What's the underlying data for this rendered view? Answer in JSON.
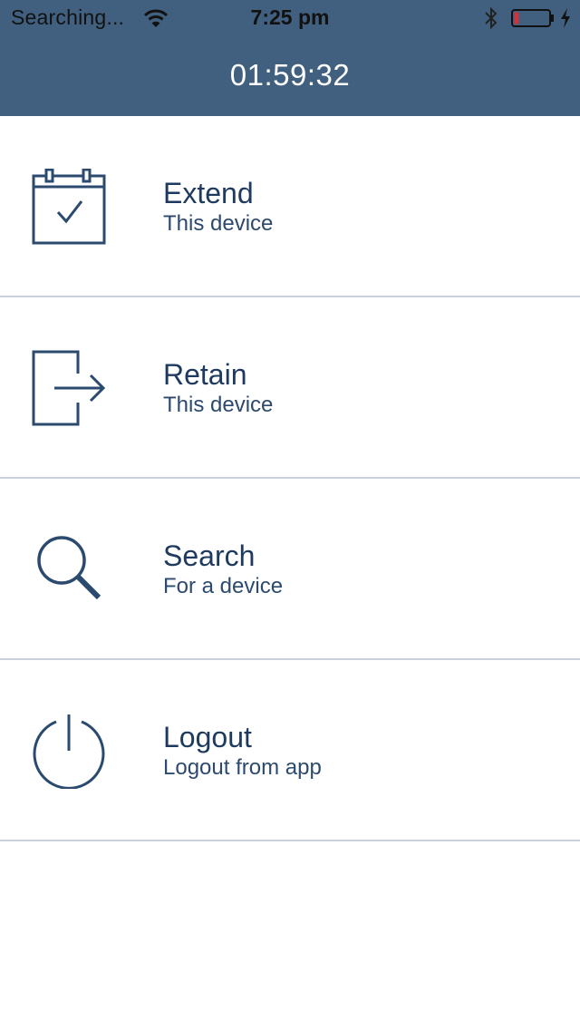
{
  "status_bar": {
    "carrier": "Searching...",
    "time": "7:25 pm"
  },
  "header": {
    "timer": "01:59:32"
  },
  "menu": {
    "items": [
      {
        "title": "Extend",
        "subtitle": "This device",
        "icon": "calendar-check-icon"
      },
      {
        "title": "Retain",
        "subtitle": "This device",
        "icon": "exit-arrow-icon"
      },
      {
        "title": "Search",
        "subtitle": "For a device",
        "icon": "search-icon"
      },
      {
        "title": "Logout",
        "subtitle": "Logout from app",
        "icon": "power-icon"
      }
    ]
  },
  "colors": {
    "header_bg": "#41607f",
    "accent": "#1e3a5f",
    "divider": "#c9d1db",
    "battery_low": "#d0343a"
  }
}
